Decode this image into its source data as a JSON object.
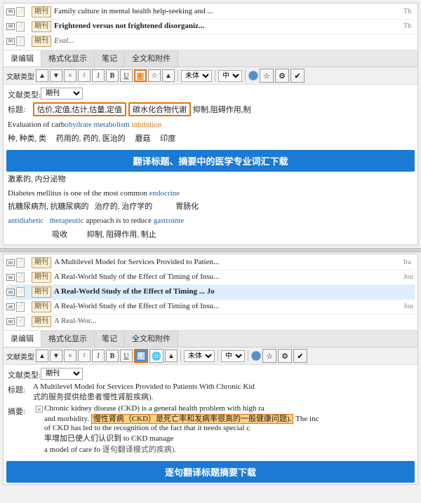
{
  "top_list": {
    "rows": [
      {
        "type": "期刊",
        "bold": false,
        "title": "Family culture in mental health help-seeking and ...",
        "suffix": "Th"
      },
      {
        "type": "期刊",
        "bold": true,
        "title": "Frightened versus not frightened disorganiz...",
        "suffix": "Th"
      },
      {
        "type": "期刊",
        "bold": false,
        "title": "",
        "suffix": ""
      }
    ]
  },
  "top_tabs": [
    "录编辑",
    "格式化显示",
    "笔记",
    "全文和附件"
  ],
  "top_toolbar": {
    "label": "文献类型",
    "buttons": [
      "▲",
      "▼",
      "×",
      "²",
      "I",
      "B",
      "U",
      "图",
      "☆",
      "▲",
      "未体"
    ],
    "align": "中",
    "highlight_btn": "图"
  },
  "top_form": {
    "type_label": "文献类型:",
    "type_value": "期刊",
    "title_label": "标题:",
    "title_keywords": [
      "估价,定值,估计,估量,定值"
    ],
    "title_keywords2": [
      "碳水化合物代谢"
    ],
    "title_extra": "抑制,阻碍作用,制",
    "content_lines": [
      {
        "parts": [
          {
            "text": "Evaluation of carb",
            "color": "black"
          },
          {
            "text": "ohydrate metabolism",
            "color": "blue"
          },
          {
            "text": " inhibition",
            "color": "orange"
          }
        ]
      },
      {
        "parts": [
          {
            "text": "种, 种类, 类  ",
            "color": "black"
          },
          {
            "text": "药用的, 药的, 医治的",
            "color": "black"
          },
          {
            "text": "    蘑菇",
            "color": "black"
          },
          {
            "text": "    印度",
            "color": "black"
          }
        ]
      }
    ]
  },
  "banner1": "翻译标题、摘要中的医学专业词汇下载",
  "abstract_lines_top": [
    {
      "parts": [
        {
          "text": "激素的, 内分泌物",
          "color": "black"
        }
      ]
    },
    {
      "parts": [
        {
          "text": "Diabetes mellitus is one of the most common",
          "color": "black"
        },
        {
          "text": " endocrine",
          "color": "blue"
        }
      ]
    },
    {
      "parts": [
        {
          "text": "抗糖尿病剂, 抗糖尿病的  治疗的, 治疗学的",
          "color": "black"
        },
        {
          "text": "               胃肠化",
          "color": "black"
        }
      ]
    },
    {
      "parts": [
        {
          "text": "antidiabetic",
          "color": "blue"
        },
        {
          "text": "  ",
          "color": "black"
        },
        {
          "text": "therapeutic",
          "color": "blue"
        },
        {
          "text": "  approach is to reduce ",
          "color": "black"
        },
        {
          "text": "gastrointeS",
          "color": "blue"
        }
      ]
    },
    {
      "parts": [
        {
          "text": "                    吸收",
          "color": "black"
        },
        {
          "text": "         抑制, 阻碍作用, 制止",
          "color": "black"
        }
      ]
    }
  ],
  "middle_list": {
    "rows": [
      {
        "type": "期刊",
        "bold": false,
        "title": "A Multilevel Model for Services Provided to Patien...",
        "suffix": "Ira"
      },
      {
        "type": "期刊",
        "bold": false,
        "title": "A Real-World Study of the Effect of Timing of Insu...",
        "suffix": "Jou"
      },
      {
        "type": "期刊",
        "bold": true,
        "title": "A Real-World Study of the Effect of Timing ... Jo",
        "suffix": ""
      },
      {
        "type": "期刊",
        "bold": false,
        "title": "A Real-World Study of the Effect of Timing of Insu...",
        "suffix": "Jou"
      },
      {
        "type": "期刊",
        "bold": false,
        "title": "",
        "suffix": ""
      }
    ]
  },
  "bottom_tabs": [
    "录编辑",
    "格式化显示",
    "笔记",
    "全文和附件"
  ],
  "bottom_toolbar": {
    "label": "文献类型",
    "buttons": [
      "▲",
      "▼",
      "×",
      "²",
      "I",
      "B",
      "U",
      "图",
      "☆",
      "▲",
      "未体"
    ],
    "align": "中",
    "highlight_btn": "图"
  },
  "bottom_form": {
    "type_label": "文献类型:",
    "type_value": "期刊",
    "title_label": "标题:",
    "title_text": "A Multilevel Model for Services Provided to Patients With Chronic Kid",
    "title_cn": "式的服务提供给患者慢性肾脏疾病).",
    "abstract_label": "摘要:",
    "abstract_text1": "Chronic kidney disease (CKD) is a general health problem with high ra",
    "abstract_text2": "and morbidity.",
    "abstract_highlighted": "慢性肾病（CKD）是死亡率和发病率很高的一般健康问题).",
    "abstract_text3": "The inc",
    "abstract_text4": "of CKD has led to the recognition of the fact that it needs special c",
    "abstract_text5": "率增加已使人们认识到",
    "abstract_text6": "to CKD manage",
    "abstract_text7": "a model of care fo",
    "abstract_text8": "逐句翻译模式的疾病).",
    "abstract_text9": "a"
  },
  "banner2": "逐句翻译标题摘要下载"
}
